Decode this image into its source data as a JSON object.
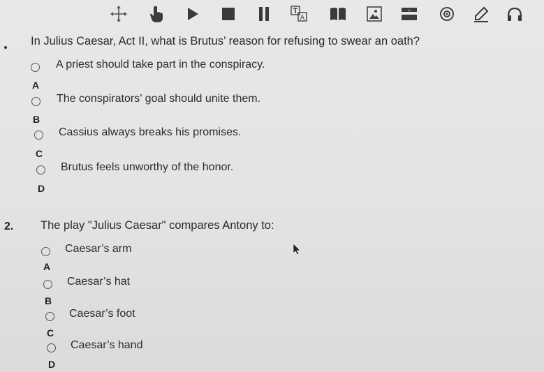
{
  "toolbar": {
    "icons": [
      "move-icon",
      "pointer-hand-icon",
      "play-icon",
      "stop-icon",
      "pause-icon",
      "text-size-icon",
      "book-icon",
      "image-icon",
      "highlight-code-icon",
      "accessibility-icon",
      "pen-icon",
      "headphones-icon"
    ],
    "text_size_label": "A",
    "code_label": "‹›"
  },
  "questions": [
    {
      "number": "",
      "text": "In Julius Caesar, Act II, what is Brutus’ reason for refusing to swear an oath?",
      "options": [
        {
          "letter": "A",
          "text": "A priest should take part in the conspiracy."
        },
        {
          "letter": "B",
          "text": "The conspirators’ goal should unite them."
        },
        {
          "letter": "C",
          "text": "Cassius always breaks his promises."
        },
        {
          "letter": "D",
          "text": "Brutus feels unworthy of the honor."
        }
      ]
    },
    {
      "number": "2.",
      "text": "The play \"Julius Caesar\" compares Antony to:",
      "options": [
        {
          "letter": "A",
          "text": "Caesar’s arm"
        },
        {
          "letter": "B",
          "text": "Caesar’s hat"
        },
        {
          "letter": "C",
          "text": "Caesar’s foot"
        },
        {
          "letter": "D",
          "text": "Caesar’s hand"
        }
      ]
    }
  ]
}
